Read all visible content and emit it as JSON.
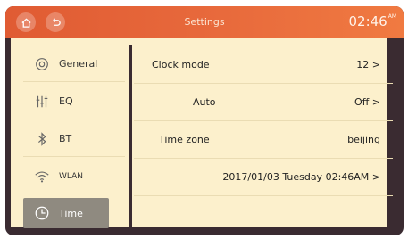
{
  "titlebar": {
    "home_icon": "home-icon",
    "back_icon": "back-icon",
    "title": "Settings",
    "clock": "02:46",
    "clock_suffix": "AM"
  },
  "sidebar": {
    "items": [
      {
        "label": "General",
        "icon": "gear-icon"
      },
      {
        "label": "EQ",
        "icon": "equalizer-icon"
      },
      {
        "label": "BT",
        "icon": "bluetooth-icon"
      },
      {
        "label": "WLAN",
        "icon": "wifi-icon"
      },
      {
        "label": "Time",
        "icon": "clock-icon",
        "active": true
      }
    ]
  },
  "settings": {
    "clock_mode": {
      "label": "Clock mode",
      "value": "12 >"
    },
    "auto": {
      "label": "Auto",
      "value": "Off >"
    },
    "time_zone": {
      "label": "Time zone",
      "value": "beijing"
    },
    "date_time": {
      "value": "2017/01/03 Tuesday 02:46AM >"
    }
  },
  "colors": {
    "titlebar": "#e86a3c",
    "panel": "#fcf0cc",
    "frame": "#3a2b31",
    "active_item": "#8f8a80"
  }
}
